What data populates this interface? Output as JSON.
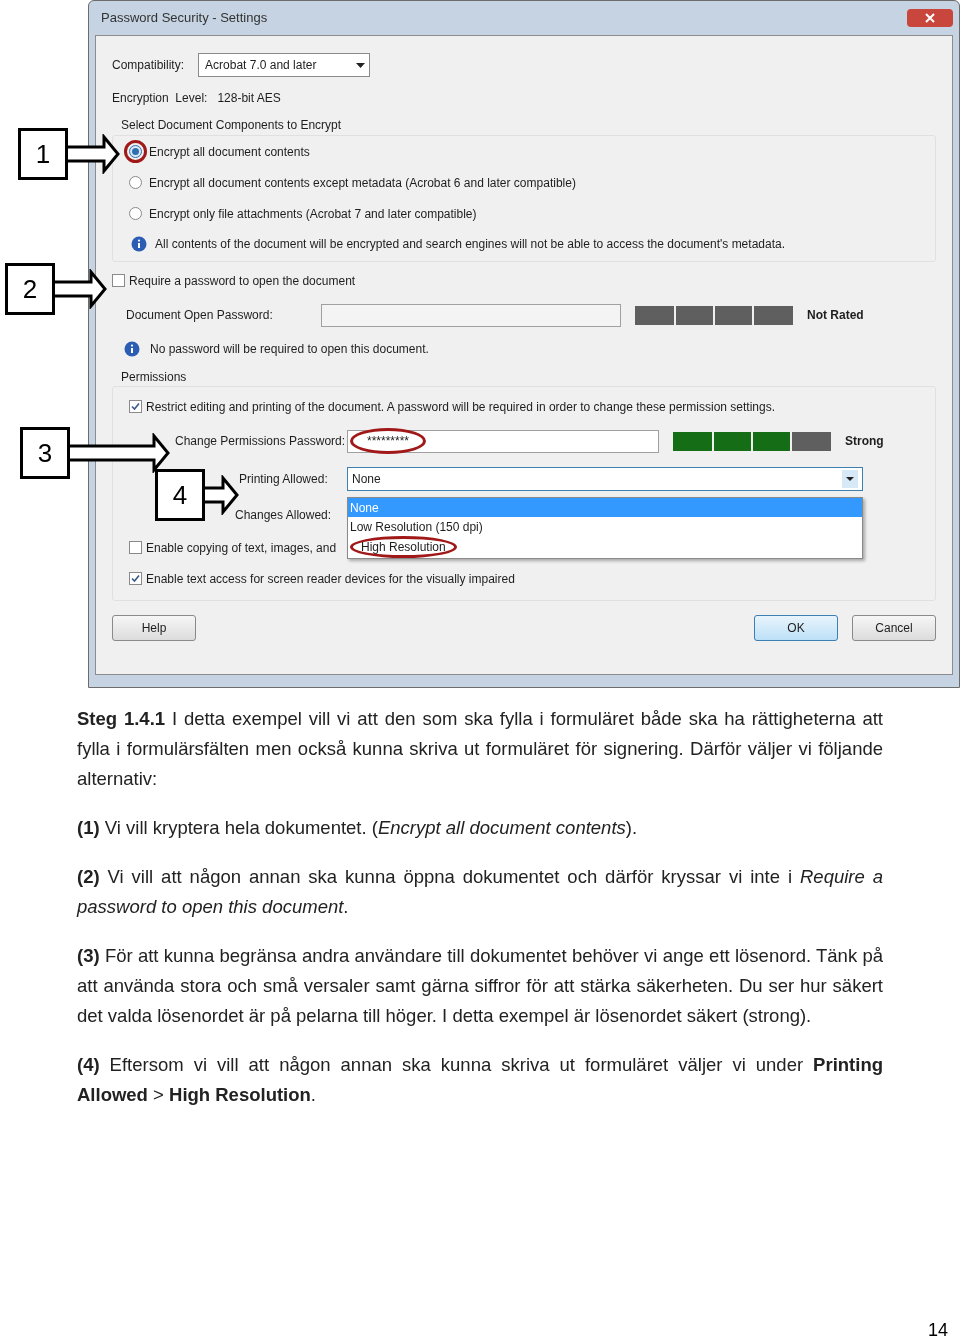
{
  "dialog": {
    "title": "Password Security - Settings",
    "compatibility": {
      "label": "Compatibility:",
      "value": "Acrobat 7.0 and later"
    },
    "encryption_level": {
      "label": "Encryption  Level:",
      "value": "128-bit AES"
    },
    "components": {
      "title": "Select Document Components to Encrypt",
      "options": [
        {
          "label": "Encrypt all document contents",
          "selected": true,
          "highlighted": true
        },
        {
          "label": "Encrypt all document contents except metadata (Acrobat 6 and later compatible)",
          "selected": false,
          "highlighted": false
        },
        {
          "label": "Encrypt only file attachments (Acrobat 7 and later compatible)",
          "selected": false,
          "highlighted": false
        }
      ],
      "info": "All contents of the document will be encrypted and search engines will not be able to access the document's metadata."
    },
    "require_open_password": {
      "label": "Require a password to open the document",
      "checked": false
    },
    "open_password": {
      "label": "Document Open Password:",
      "rating": "Not Rated"
    },
    "open_info": "No password will be required to open this document.",
    "permissions": {
      "title": "Permissions",
      "restrict": {
        "label": "Restrict editing and printing of the document. A password will be required in order to change these permission settings.",
        "checked": true
      },
      "password": {
        "label": "Change Permissions Password:",
        "value": "*********",
        "highlighted": true,
        "level": 0.75,
        "rating": "Strong"
      },
      "printing": {
        "label": "Printing Allowed:",
        "value": "None",
        "options": [
          {
            "label": "None",
            "selected": true,
            "highlighted": false
          },
          {
            "label": "Low Resolution (150 dpi)",
            "selected": false,
            "highlighted": false
          },
          {
            "label": "High Resolution",
            "selected": false,
            "highlighted": true
          }
        ]
      },
      "changes": {
        "label": "Changes Allowed:"
      },
      "checkboxes": [
        {
          "label": "Enable copying of text, images, and",
          "checked": false
        },
        {
          "label": "Enable text access for screen reader devices for the visually impaired",
          "checked": true
        }
      ]
    },
    "buttons": {
      "help": "Help",
      "ok": "OK",
      "cancel": "Cancel"
    }
  },
  "callouts": [
    "1",
    "2",
    "3",
    "4"
  ],
  "paragraphs": [
    "**Steg 1.4.1** I detta exempel vill vi att den som ska fylla i formuläret både ska ha rättigheterna att fylla i formulärsfälten men också kunna skriva ut formuläret för signering. Därför väljer vi följande alternativ:",
    "**(1)** Vi vill kryptera hela dokumentet. (*Encrypt all document contents*).",
    "**(2)** Vi vill att någon annan ska kunna öppna dokumentet och därför kryssar vi inte i *Require a password to open this document*.",
    "**(3)** För att kunna begränsa andra användare till dokumentet behöver vi ange ett lösenord. Tänk på att använda stora och små versaler samt gärna siffror för att stärka säkerheten. Du ser hur säkert det valda lösenordet är på pelarna till höger. I detta exempel är lösenordet säkert (strong).",
    "**(4)** Eftersom vi vill att någon annan ska kunna skriva ut formuläret väljer vi under **Printing Allowed** > **High Resolution**."
  ],
  "page_number": "14"
}
